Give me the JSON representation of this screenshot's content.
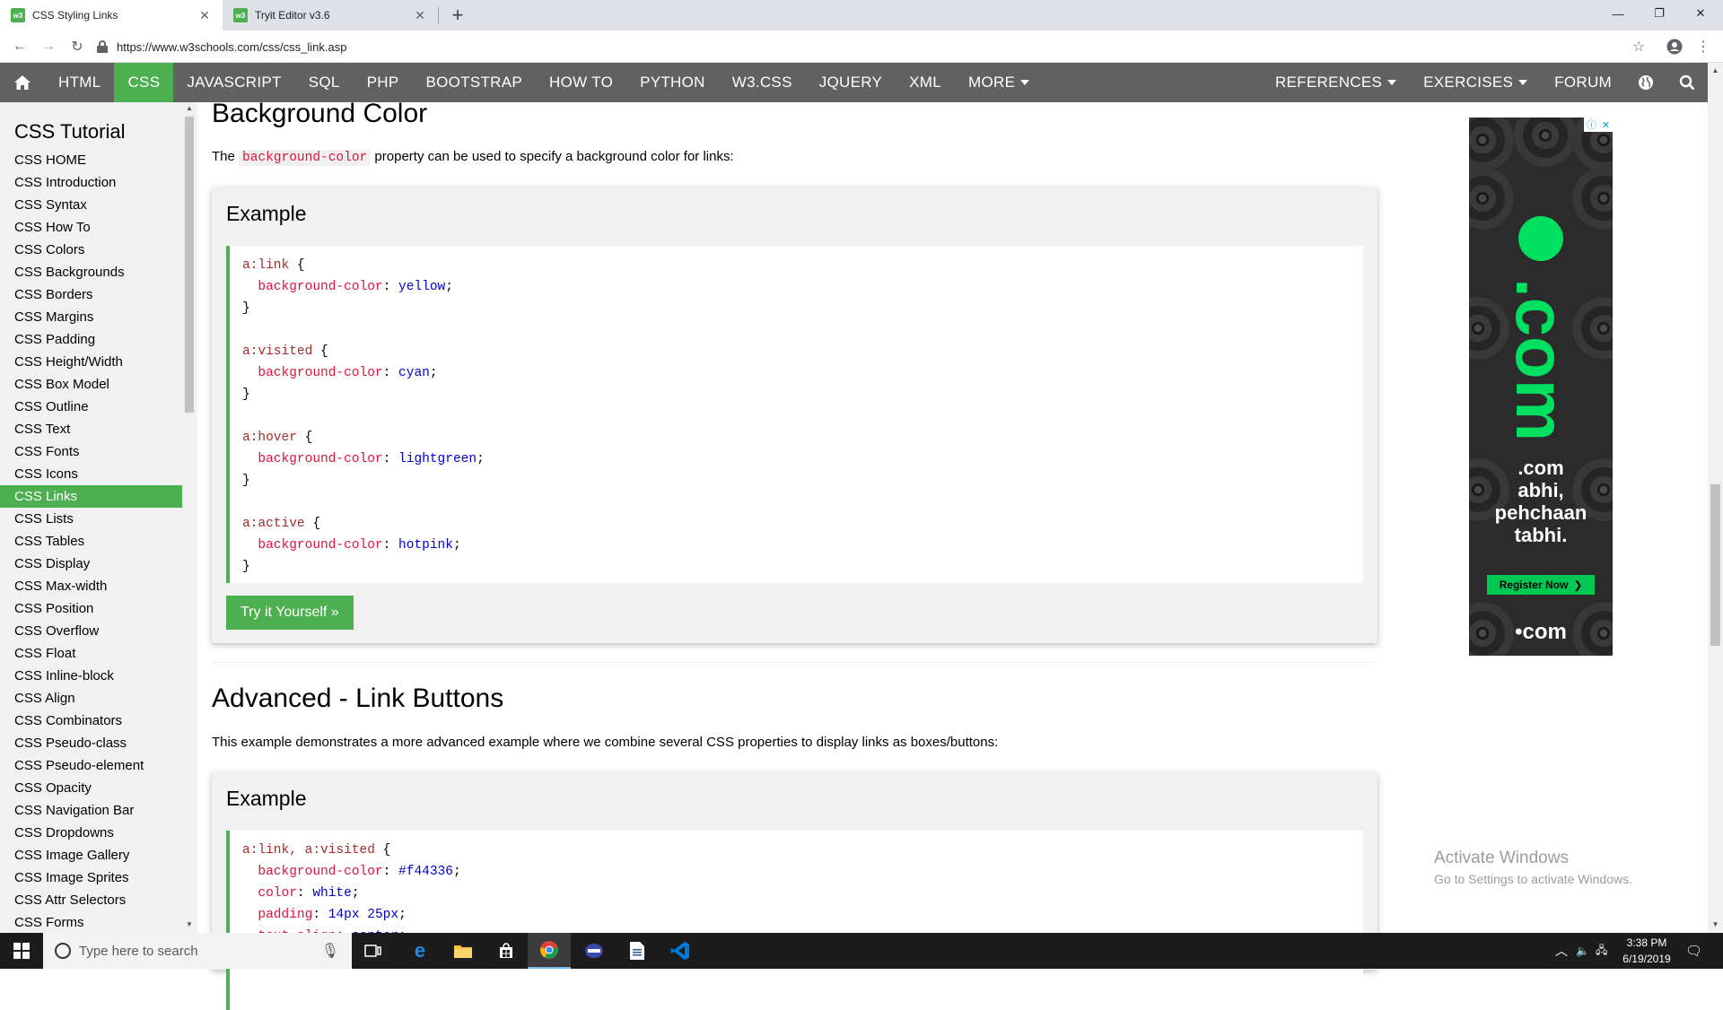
{
  "browser": {
    "tabs": [
      {
        "favicon": "w3",
        "title": "CSS Styling Links",
        "active": true
      },
      {
        "favicon": "w3",
        "title": "Tryit Editor v3.6",
        "active": false
      }
    ],
    "url": "https://www.w3schools.com/css/css_link.asp"
  },
  "topnav": {
    "items": [
      "HTML",
      "CSS",
      "JAVASCRIPT",
      "SQL",
      "PHP",
      "BOOTSTRAP",
      "HOW TO",
      "PYTHON",
      "W3.CSS",
      "JQUERY",
      "XML",
      "MORE"
    ],
    "right_items": [
      "REFERENCES",
      "EXERCISES",
      "FORUM"
    ]
  },
  "sidebar": {
    "title": "CSS Tutorial",
    "items": [
      "CSS HOME",
      "CSS Introduction",
      "CSS Syntax",
      "CSS How To",
      "CSS Colors",
      "CSS Backgrounds",
      "CSS Borders",
      "CSS Margins",
      "CSS Padding",
      "CSS Height/Width",
      "CSS Box Model",
      "CSS Outline",
      "CSS Text",
      "CSS Fonts",
      "CSS Icons",
      "CSS Links",
      "CSS Lists",
      "CSS Tables",
      "CSS Display",
      "CSS Max-width",
      "CSS Position",
      "CSS Overflow",
      "CSS Float",
      "CSS Inline-block",
      "CSS Align",
      "CSS Combinators",
      "CSS Pseudo-class",
      "CSS Pseudo-element",
      "CSS Opacity",
      "CSS Navigation Bar",
      "CSS Dropdowns",
      "CSS Image Gallery",
      "CSS Image Sprites",
      "CSS Attr Selectors",
      "CSS Forms"
    ],
    "active": "CSS Links"
  },
  "section1": {
    "heading": "Background Color",
    "intro_before": "The ",
    "intro_code": "background-color",
    "intro_after": " property can be used to specify a background color for links:",
    "example_label": "Example",
    "code": [
      [
        [
          "sel",
          "a:link"
        ],
        [
          "pun",
          " {"
        ]
      ],
      [
        [
          "pun",
          "  "
        ],
        [
          "prop",
          "background-color"
        ],
        [
          "pun",
          ": "
        ],
        [
          "val",
          "yellow"
        ],
        [
          "pun",
          ";"
        ]
      ],
      [
        [
          "pun",
          "}"
        ]
      ],
      [
        [
          "pun",
          ""
        ]
      ],
      [
        [
          "sel",
          "a:visited"
        ],
        [
          "pun",
          " {"
        ]
      ],
      [
        [
          "pun",
          "  "
        ],
        [
          "prop",
          "background-color"
        ],
        [
          "pun",
          ": "
        ],
        [
          "val",
          "cyan"
        ],
        [
          "pun",
          ";"
        ]
      ],
      [
        [
          "pun",
          "}"
        ]
      ],
      [
        [
          "pun",
          ""
        ]
      ],
      [
        [
          "sel",
          "a:hover"
        ],
        [
          "pun",
          " {"
        ]
      ],
      [
        [
          "pun",
          "  "
        ],
        [
          "prop",
          "background-color"
        ],
        [
          "pun",
          ": "
        ],
        [
          "val",
          "lightgreen"
        ],
        [
          "pun",
          ";"
        ]
      ],
      [
        [
          "pun",
          "}"
        ]
      ],
      [
        [
          "pun",
          ""
        ]
      ],
      [
        [
          "sel",
          "a:active"
        ],
        [
          "pun",
          " {"
        ]
      ],
      [
        [
          "pun",
          "  "
        ],
        [
          "prop",
          "background-color"
        ],
        [
          "pun",
          ": "
        ],
        [
          "val",
          "hotpink"
        ],
        [
          "pun",
          ";"
        ]
      ],
      [
        [
          "pun",
          "}"
        ]
      ]
    ],
    "try_label": "Try it Yourself »"
  },
  "section2": {
    "heading": "Advanced - Link Buttons",
    "intro": "This example demonstrates a more advanced example where we combine several CSS properties to display links as boxes/buttons:",
    "example_label": "Example",
    "code": [
      [
        [
          "sel",
          "a:link, a:visited"
        ],
        [
          "pun",
          " {"
        ]
      ],
      [
        [
          "pun",
          "  "
        ],
        [
          "prop",
          "background-color"
        ],
        [
          "pun",
          ": "
        ],
        [
          "val",
          "#f44336"
        ],
        [
          "pun",
          ";"
        ]
      ],
      [
        [
          "pun",
          "  "
        ],
        [
          "prop",
          "color"
        ],
        [
          "pun",
          ": "
        ],
        [
          "val",
          "white"
        ],
        [
          "pun",
          ";"
        ]
      ],
      [
        [
          "pun",
          "  "
        ],
        [
          "prop",
          "padding"
        ],
        [
          "pun",
          ": "
        ],
        [
          "val",
          "14px 25px"
        ],
        [
          "pun",
          ";"
        ]
      ],
      [
        [
          "pun",
          "  "
        ],
        [
          "prop",
          "text-align"
        ],
        [
          "pun",
          ": "
        ],
        [
          "val",
          "center"
        ],
        [
          "pun",
          ";"
        ]
      ]
    ]
  },
  "ad": {
    "brand": ".com",
    "tagline": [
      "abhi,",
      "pehchaan",
      "tabhi."
    ],
    "cta": "Register Now",
    "footer": "•com"
  },
  "watermark": {
    "line1": "Activate Windows",
    "line2": "Go to Settings to activate Windows."
  },
  "taskbar": {
    "search_placeholder": "Type here to search",
    "time": "3:38 PM",
    "date": "6/19/2019"
  },
  "colors": {
    "brand_green": "#4caf50",
    "nav_gray": "#616161",
    "code_selector": "#a52a2a",
    "code_property": "#dc143c",
    "code_value": "#0000cd"
  }
}
